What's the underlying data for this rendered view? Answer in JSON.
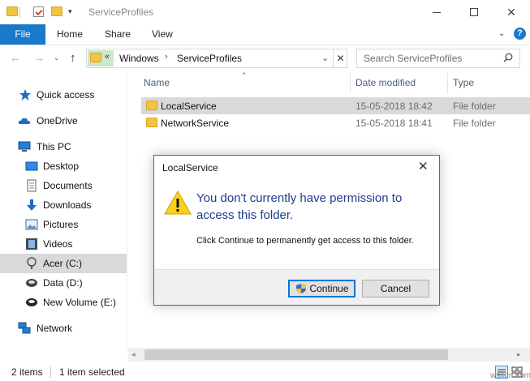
{
  "window": {
    "title": "ServiceProfiles",
    "qa_dropdown": "▾",
    "min_label": "",
    "close_glyph": "✕"
  },
  "ribbon": {
    "tabs": [
      {
        "label": "File"
      },
      {
        "label": "Home"
      },
      {
        "label": "Share"
      },
      {
        "label": "View"
      }
    ],
    "expand_glyph": "⌄",
    "help_glyph": "?"
  },
  "nav": {
    "back": "←",
    "forward": "→",
    "recent": "⌄",
    "up": "↑",
    "chevron": "«",
    "breadcrumbs": [
      "Windows",
      "ServiceProfiles"
    ],
    "crumb_sep": "›",
    "address_dropdown": "⌄",
    "address_clear": "✕",
    "search_placeholder": "Search ServiceProfiles"
  },
  "sidebar": {
    "items": [
      {
        "label": "Quick access",
        "icon": "star-icon"
      },
      {
        "label": "OneDrive",
        "icon": "cloud-icon"
      },
      {
        "label": "This PC",
        "icon": "computer-icon"
      },
      {
        "label": "Desktop",
        "icon": "desktop-icon"
      },
      {
        "label": "Documents",
        "icon": "documents-icon"
      },
      {
        "label": "Downloads",
        "icon": "download-icon"
      },
      {
        "label": "Pictures",
        "icon": "pictures-icon"
      },
      {
        "label": "Videos",
        "icon": "videos-icon"
      },
      {
        "label": "Acer (C:)",
        "icon": "drive-icon",
        "selected": true
      },
      {
        "label": "Data (D:)",
        "icon": "drive-icon"
      },
      {
        "label": "New Volume (E:)",
        "icon": "drive-icon"
      },
      {
        "label": "Network",
        "icon": "network-icon"
      }
    ]
  },
  "list": {
    "columns": [
      "Name",
      "Date modified",
      "Type"
    ],
    "sort_glyph": "⌃",
    "rows": [
      {
        "name": "LocalService",
        "date": "15-05-2018 18:42",
        "type": "File folder",
        "selected": true
      },
      {
        "name": "NetworkService",
        "date": "15-05-2018 18:41",
        "type": "File folder",
        "selected": false
      }
    ]
  },
  "scrollbar": {
    "left_glyph": "◂",
    "right_glyph": "▸"
  },
  "status": {
    "count": "2 items",
    "selected": "1 item selected"
  },
  "watermark": "wsxdn.com",
  "dialog": {
    "title": "LocalService",
    "close_glyph": "✕",
    "heading": "You don't currently have permission to access this folder.",
    "body": "Click Continue to permanently get access to this folder.",
    "continue_label": "Continue",
    "cancel_label": "Cancel"
  },
  "colors": {
    "accent": "#1979ca",
    "heading_blue": "#1c3d8f",
    "folder_yellow": "#f5c342",
    "selection_gray": "#d9d9d9"
  }
}
